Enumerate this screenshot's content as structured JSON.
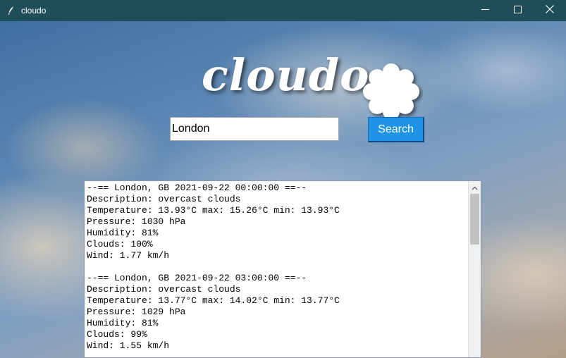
{
  "window": {
    "title": "cloudo",
    "app_icon": "feather-icon",
    "controls": [
      "minimize-icon",
      "maximize-icon",
      "close-icon"
    ]
  },
  "logo": {
    "text": "cloudo",
    "icon": "cloud-flower-icon"
  },
  "search": {
    "value": "London",
    "button_label": "Search"
  },
  "results": [
    {
      "header": "--== London, GB 2021-09-22 00:00:00 ==--",
      "description": "Description: overcast clouds",
      "temperature": "Temperature: 13.93°C max: 15.26°C min: 13.93°C",
      "pressure": "Pressure: 1030 hPa",
      "humidity": "Humidity: 81%",
      "clouds": "Clouds: 100%",
      "wind": "Wind: 1.77 km/h"
    },
    {
      "header": "--== London, GB 2021-09-22 03:00:00 ==--",
      "description": "Description: overcast clouds",
      "temperature": "Temperature: 13.77°C max: 14.02°C min: 13.77°C",
      "pressure": "Pressure: 1029 hPa",
      "humidity": "Humidity: 81%",
      "clouds": "Clouds: 99%",
      "wind": "Wind: 1.55 km/h"
    }
  ],
  "colors": {
    "titlebar": "#1f4e5a",
    "button": "#1f93e6"
  }
}
